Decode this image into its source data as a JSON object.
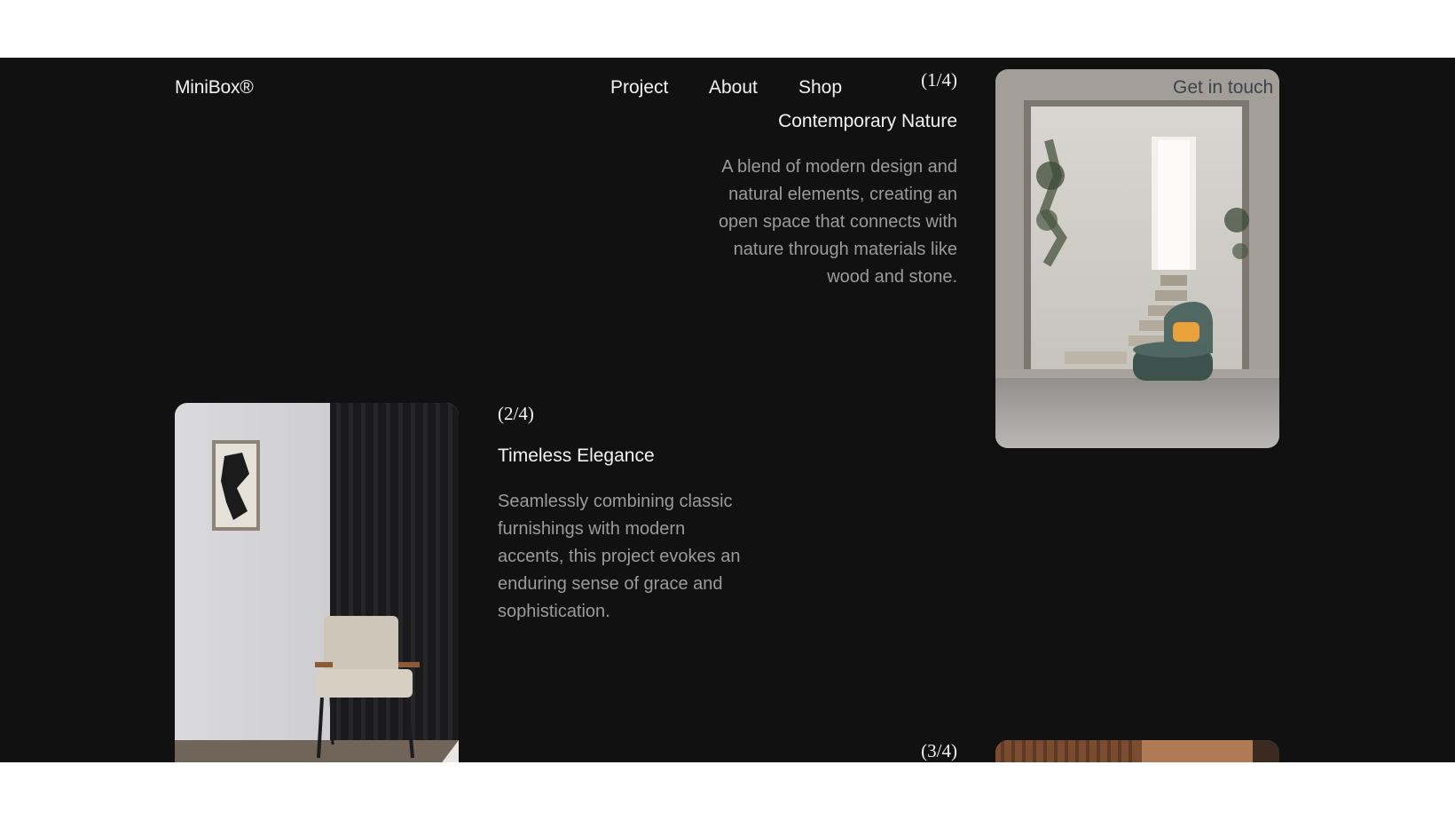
{
  "brand": {
    "logo": "MiniBox®"
  },
  "nav": {
    "items": [
      "Project",
      "About",
      "Shop"
    ],
    "cta": "Get in touch"
  },
  "projects": [
    {
      "counter": "(1/4)",
      "title": "Contemporary Nature",
      "description": "A blend of modern design and natural elements, creating an open space that connects with nature through materials like wood and stone."
    },
    {
      "counter": "(2/4)",
      "title": "Timeless Elegance",
      "description": "Seamlessly combining classic furnishings with modern accents, this project evokes an enduring sense of grace and sophistication."
    },
    {
      "counter": "(3/4)"
    }
  ],
  "colors": {
    "page_bg": "#ffffff",
    "stage_bg": "#111112",
    "text_primary": "#f2f2f2",
    "text_muted": "#9b9b9b",
    "cta_text": "#3a4350"
  }
}
